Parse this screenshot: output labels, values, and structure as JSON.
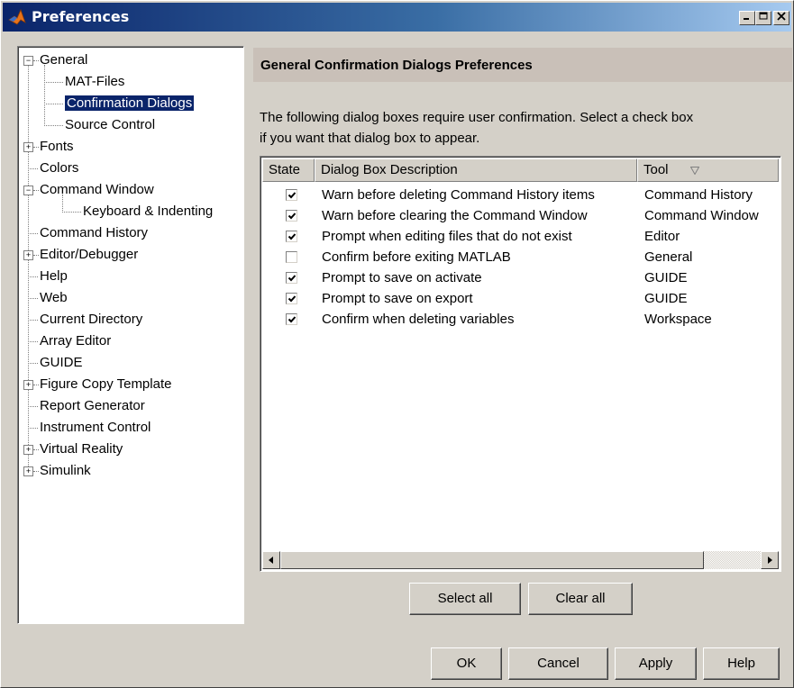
{
  "window": {
    "title": "Preferences"
  },
  "tree": [
    {
      "label": "General",
      "expander": "−"
    },
    {
      "label": "MAT-Files"
    },
    {
      "label": "Confirmation Dialogs",
      "selected": true
    },
    {
      "label": "Source Control"
    },
    {
      "label": "Fonts",
      "expander": "+"
    },
    {
      "label": "Colors"
    },
    {
      "label": "Command Window",
      "expander": "−"
    },
    {
      "label": "Keyboard & Indenting"
    },
    {
      "label": "Command History"
    },
    {
      "label": "Editor/Debugger",
      "expander": "+"
    },
    {
      "label": "Help"
    },
    {
      "label": "Web"
    },
    {
      "label": "Current Directory"
    },
    {
      "label": "Array Editor"
    },
    {
      "label": "GUIDE"
    },
    {
      "label": "Figure Copy Template",
      "expander": "+"
    },
    {
      "label": "Report Generator"
    },
    {
      "label": "Instrument Control"
    },
    {
      "label": "Virtual Reality",
      "expander": "+"
    },
    {
      "label": "Simulink",
      "expander": "+"
    }
  ],
  "panel": {
    "title": "General Confirmation Dialogs Preferences",
    "instruction_line1": "The following dialog boxes require user confirmation.  Select a check box",
    "instruction_line2": "if you want that dialog box to appear."
  },
  "table": {
    "headers": [
      "State",
      "Dialog Box Description",
      "Tool"
    ],
    "sort_icon": "sort-down-triangle-icon",
    "rows": [
      {
        "checked": true,
        "description": "Warn before deleting Command History items",
        "tool": "Command History"
      },
      {
        "checked": true,
        "description": "Warn before clearing the Command Window",
        "tool": "Command Window"
      },
      {
        "checked": true,
        "description": "Prompt when editing files that do not exist",
        "tool": "Editor"
      },
      {
        "checked": false,
        "description": "Confirm before exiting MATLAB",
        "tool": "General"
      },
      {
        "checked": true,
        "description": "Prompt to save on activate",
        "tool": "GUIDE"
      },
      {
        "checked": true,
        "description": "Prompt to save on export",
        "tool": "GUIDE"
      },
      {
        "checked": true,
        "description": "Confirm when deleting variables",
        "tool": "Workspace"
      }
    ]
  },
  "buttons": {
    "select_all": "Select all",
    "clear_all": "Clear all",
    "ok": "OK",
    "cancel": "Cancel",
    "apply": "Apply",
    "help": "Help"
  },
  "colors": {
    "selection": "#0a246a",
    "title_bar_start": "#0a246a",
    "title_bar_end": "#a6caf0",
    "panel_header": "#c9c0b8",
    "face": "#d4d0c8"
  }
}
